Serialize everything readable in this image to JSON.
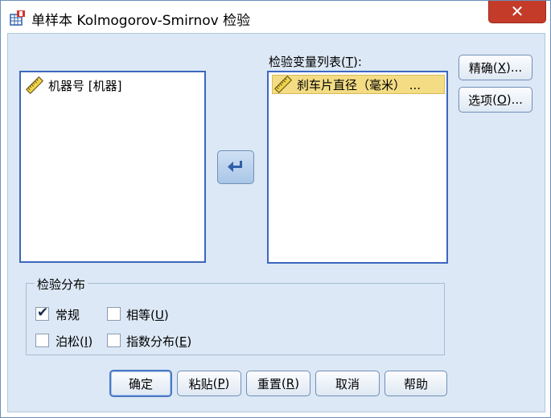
{
  "window": {
    "title": "单样本 Kolmogorov-Smirnov 检验",
    "close_label": "✕"
  },
  "source_list": {
    "items": [
      {
        "label": "机器号 [机器]",
        "icon": "ruler-scale-icon"
      }
    ]
  },
  "move_button": {
    "icon": "arrow-left-icon"
  },
  "test_variable_list": {
    "label": "检验变量列表",
    "accel": "T",
    "items": [
      {
        "label": "刹车片直径（毫米） ...",
        "icon": "ruler-scale-icon",
        "selected": true
      }
    ]
  },
  "side_buttons": {
    "exact": {
      "text": "精确",
      "accel": "X",
      "suffix": "..."
    },
    "options": {
      "text": "选项",
      "accel": "O",
      "suffix": "..."
    }
  },
  "distribution": {
    "title": "检验分布",
    "normal": {
      "label": "常规",
      "checked": true
    },
    "uniform": {
      "text": "相等",
      "accel": "U",
      "checked": false
    },
    "poisson": {
      "text": "泊松",
      "accel": "I",
      "checked": false
    },
    "exponential": {
      "text": "指数分布",
      "accel": "E",
      "checked": false
    }
  },
  "bottom_buttons": {
    "ok": {
      "label": "确定"
    },
    "paste": {
      "text": "粘贴",
      "accel": "P"
    },
    "reset": {
      "text": "重置",
      "accel": "R"
    },
    "cancel": {
      "label": "取消"
    },
    "help": {
      "label": "帮助"
    }
  },
  "colors": {
    "listbox_border": "#3b67bf",
    "selection": "#f3dc84",
    "dialog_bg": "#dce8f5",
    "close_button": "#c43b2a"
  }
}
